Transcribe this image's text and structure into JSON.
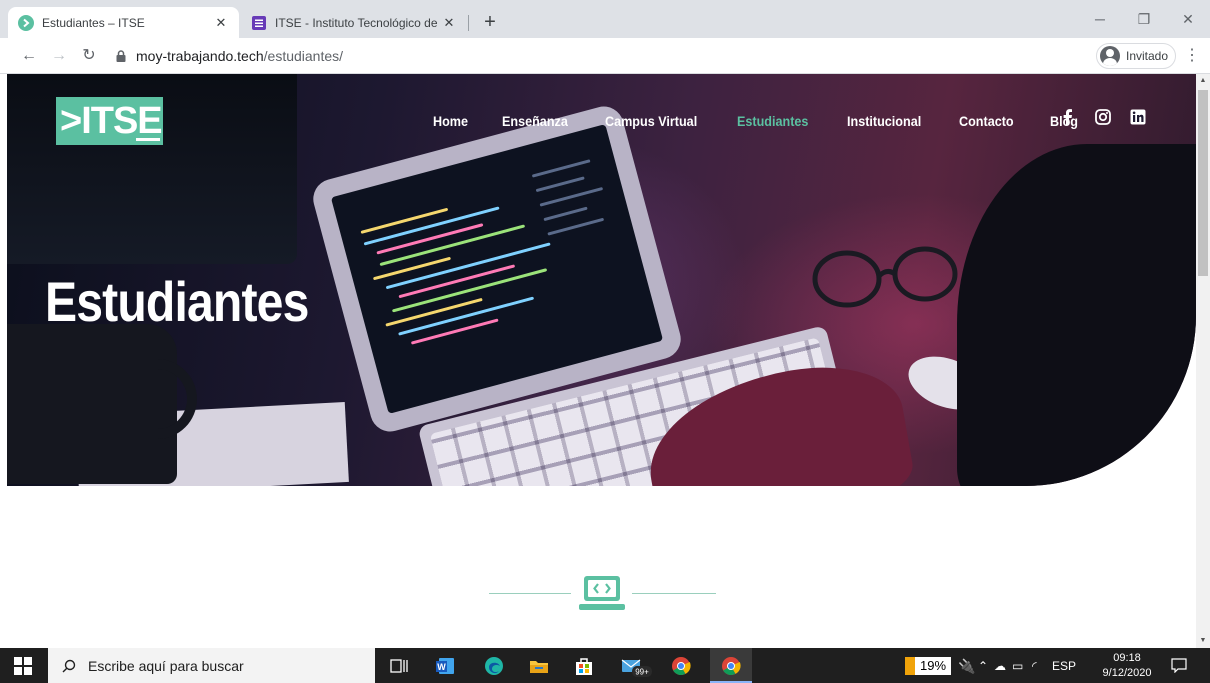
{
  "browser": {
    "tabs": [
      {
        "title": "Estudiantes – ITSE",
        "active": true
      },
      {
        "title": "ITSE - Instituto Tecnológico de Se",
        "active": false
      }
    ],
    "new_tab_label": "+",
    "url_host": "moy-trabajando.tech",
    "url_path": "/estudiantes/",
    "profile_label": "Invitado"
  },
  "site": {
    "logo_text": ">ITSE",
    "nav": [
      {
        "label": "Home",
        "active": false
      },
      {
        "label": "Enseñanza",
        "active": false
      },
      {
        "label": "Campus Virtual",
        "active": false
      },
      {
        "label": "Estudiantes",
        "active": true
      },
      {
        "label": "Institucional",
        "active": false
      },
      {
        "label": "Contacto",
        "active": false
      },
      {
        "label": "Blog",
        "active": false
      }
    ],
    "social_icons": [
      "facebook-icon",
      "instagram-icon",
      "linkedin-icon"
    ],
    "hero_title": "Estudiantes",
    "accent_color": "#5bc0a1"
  },
  "taskbar": {
    "search_placeholder": "Escribe aquí para buscar",
    "battery": "19%",
    "language": "ESP",
    "time": "09:18",
    "date": "9/12/2020",
    "store_badge": "99+"
  }
}
